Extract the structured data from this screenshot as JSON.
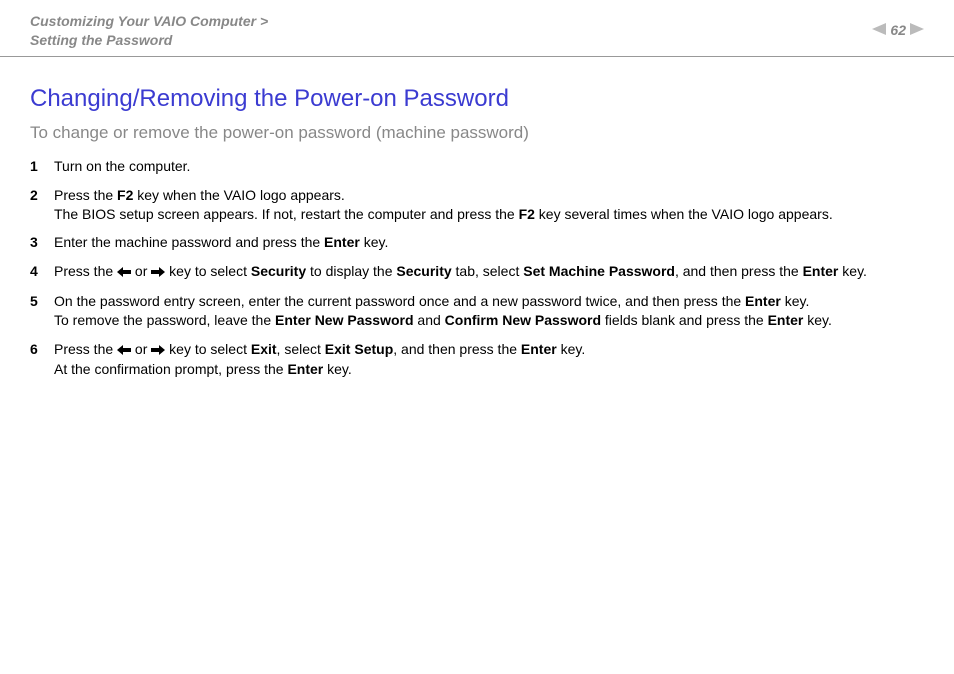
{
  "header": {
    "breadcrumb_line1": "Customizing Your VAIO Computer >",
    "breadcrumb_line2": "Setting the Password",
    "page_number": "62"
  },
  "title": "Changing/Removing the Power-on Password",
  "subtitle": "To change or remove the power-on password (machine password)",
  "steps": [
    {
      "num": "1",
      "html": "Turn on the computer."
    },
    {
      "num": "2",
      "html": "Press the <b>F2</b> key when the VAIO logo appears.<br>The BIOS setup screen appears. If not, restart the computer and press the <b>F2</b> key several times when the VAIO logo appears."
    },
    {
      "num": "3",
      "html": "Enter the machine password and press the <b>Enter</b> key."
    },
    {
      "num": "4",
      "html": "Press the __LARR__ or __RARR__ key to select <b>Security</b> to display the <b>Security</b> tab, select <b>Set Machine Password</b>, and then press the <b>Enter</b> key."
    },
    {
      "num": "5",
      "html": "On the password entry screen, enter the current password once and a new password twice, and then press the <b>Enter</b> key.<br>To remove the password, leave the <b>Enter New Password</b> and <b>Confirm New Password</b> fields blank and press the <b>Enter</b> key."
    },
    {
      "num": "6",
      "html": "Press the __LARR__ or __RARR__ key to select <b>Exit</b>, select <b>Exit Setup</b>, and then press the <b>Enter</b> key.<br>At the confirmation prompt, press the <b>Enter</b> key."
    }
  ],
  "icons": {
    "left_arrow_svg": "<svg width='14' height='10' viewBox='0 0 14 10'><path d='M0 5 L6 0 L6 3 L14 3 L14 7 L6 7 L6 10 Z' fill='#000'/></svg>",
    "right_arrow_svg": "<svg width='14' height='10' viewBox='0 0 14 10'><path d='M14 5 L8 0 L8 3 L0 3 L0 7 L8 7 L8 10 Z' fill='#000'/></svg>",
    "nav_left_svg": "<svg width='14' height='12' viewBox='0 0 14 12'><path d='M14 0 L0 6 L14 12 Z' fill='#bbb'/></svg>",
    "nav_right_svg": "<svg width='14' height='12' viewBox='0 0 14 12'><path d='M0 0 L14 6 L0 12 Z' fill='#bbb'/></svg>"
  }
}
